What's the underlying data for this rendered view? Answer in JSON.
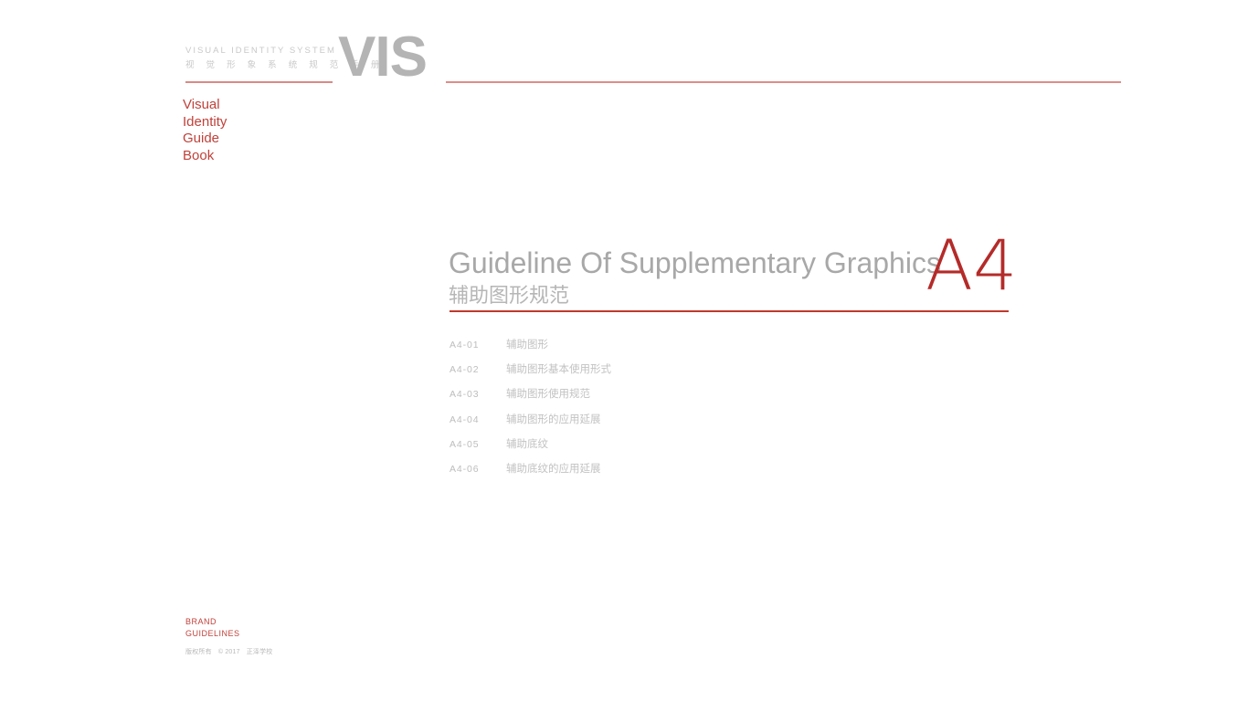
{
  "masthead": {
    "english": "VISUAL  IDENTITY  SYSTEM",
    "chinese": "视 觉 形 象 系 统 规 范 手 册",
    "logo": "VIS"
  },
  "brand_words": {
    "line1": "Visual",
    "line2": "Identity",
    "line3": "Guide",
    "line4": "Book"
  },
  "section": {
    "title_en": "Guideline Of Supplementary Graphics",
    "title_cn": "辅助图形规范",
    "marker": "A4"
  },
  "toc": {
    "items": [
      {
        "code": "A4-01",
        "label": "辅助图形"
      },
      {
        "code": "A4-02",
        "label": "辅助图形基本使用形式"
      },
      {
        "code": "A4-03",
        "label": "辅助图形使用规范"
      },
      {
        "code": "A4-04",
        "label": "辅助图形的应用延展"
      },
      {
        "code": "A4-05",
        "label": "辅助底纹"
      },
      {
        "code": "A4-06",
        "label": "辅助底纹的应用延展"
      }
    ]
  },
  "footer": {
    "brand_line1": "BRAND",
    "brand_line2": "GUIDELINES",
    "copyright_label": "版权所有",
    "copyright_mark": "© 2017",
    "owner": "正泽学校"
  },
  "colors": {
    "accent_red": "#c0392b",
    "rule_red_light": "#dd8d88",
    "logo_grey": "#b4b4b4",
    "text_grey": "#c2c2c2"
  }
}
